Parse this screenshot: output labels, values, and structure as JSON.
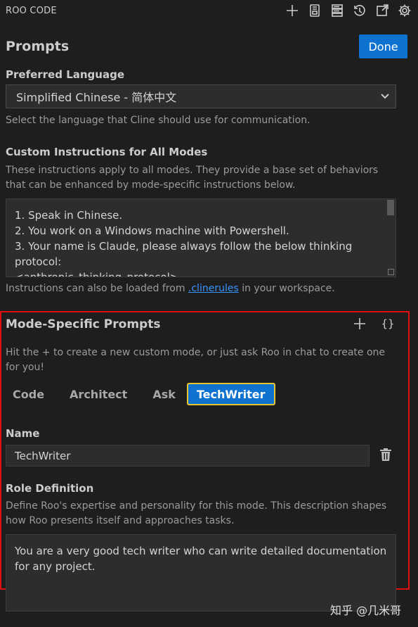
{
  "app": {
    "title": "ROO CODE"
  },
  "toolbar": {
    "icons": [
      "plus-icon",
      "notebook-icon",
      "server-icon",
      "history-icon",
      "external-link-icon",
      "gear-icon"
    ]
  },
  "header": {
    "title": "Prompts",
    "done_label": "Done"
  },
  "language": {
    "label": "Preferred Language",
    "selected": "Simplified Chinese - 简体中文",
    "description": "Select the language that Cline should use for communication."
  },
  "custom_instructions": {
    "label": "Custom Instructions for All Modes",
    "description": "These instructions apply to all modes. They provide a base set of behaviors that can be enhanced by mode-specific instructions below.",
    "lines": [
      "1. Speak in Chinese.",
      "2. You work on a Windows machine with Powershell.",
      "3. Your name is Claude, please always follow the below thinking protocol:",
      "<anthropic_thinking_protocol>"
    ],
    "note_prefix": "Instructions can also be loaded from ",
    "note_link": ".clinerules",
    "note_suffix": " in your workspace."
  },
  "mode_specific": {
    "title": "Mode-Specific Prompts",
    "braces_label": "{}",
    "description": "Hit the + to create a new custom mode, or just ask Roo in chat to create one for you!",
    "tabs": [
      "Code",
      "Architect",
      "Ask",
      "TechWriter"
    ],
    "active_tab": "TechWriter",
    "name_label": "Name",
    "name_value": "TechWriter",
    "role_label": "Role Definition",
    "role_description": "Define Roo's expertise and personality for this mode. This description shapes how Roo presents itself and approaches tasks.",
    "role_value": "You are a very good tech writer who can write detailed documentation for any project."
  },
  "colors": {
    "accent": "#0e72d1",
    "highlight_border": "#e01010",
    "active_tab_border": "#e8c532",
    "link": "#3794ff"
  },
  "watermark": "知乎 @几米哥"
}
